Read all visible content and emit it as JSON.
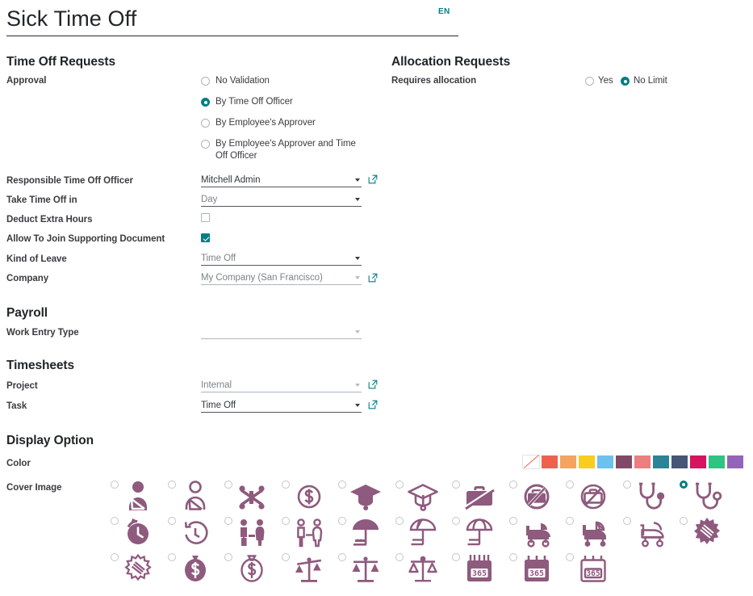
{
  "header": {
    "title": "Sick Time Off",
    "language_badge": "EN"
  },
  "groups": {
    "time_off_requests": "Time Off Requests",
    "allocation_requests": "Allocation Requests",
    "payroll": "Payroll",
    "timesheets": "Timesheets",
    "display_option": "Display Option"
  },
  "approval": {
    "label": "Approval",
    "options": [
      {
        "label": "No Validation",
        "selected": false
      },
      {
        "label": "By Time Off Officer",
        "selected": true
      },
      {
        "label": "By Employee's Approver",
        "selected": false
      },
      {
        "label": "By Employee's Approver and Time Off Officer",
        "selected": false
      }
    ]
  },
  "allocation": {
    "label": "Requires allocation",
    "options": [
      {
        "label": "Yes",
        "selected": false
      },
      {
        "label": "No Limit",
        "selected": true
      }
    ]
  },
  "fields": [
    {
      "label": "Responsible Time Off Officer",
      "value": "Mitchell Admin",
      "tone": "strong",
      "caret": "dark",
      "underline": "dark",
      "external": true
    },
    {
      "label": "Take Time Off in",
      "value": "Day",
      "tone": "muted",
      "caret": "dark",
      "underline": "dark",
      "external": false
    },
    {
      "label": "Kind of Leave",
      "value": "Time Off",
      "tone": "muted",
      "caret": "dark",
      "underline": "dark",
      "external": false
    },
    {
      "label": "Company",
      "value": "My Company (San Francisco)",
      "tone": "muted",
      "caret": "light",
      "underline": "light",
      "external": true
    },
    {
      "label": "Work Entry Type",
      "value": "",
      "tone": "muted",
      "caret": "light",
      "underline": "light",
      "external": false
    },
    {
      "label": "Project",
      "value": "Internal",
      "tone": "muted",
      "caret": "light",
      "underline": "light",
      "external": true
    },
    {
      "label": "Task",
      "value": "Time Off",
      "tone": "strong",
      "caret": "dark",
      "underline": "dark",
      "external": true
    }
  ],
  "checkboxes": [
    {
      "label": "Deduct Extra Hours",
      "checked": false
    },
    {
      "label": "Allow To Join Supporting Document",
      "checked": true
    }
  ],
  "color": {
    "label": "Color",
    "selected_index": 0,
    "swatches": [
      {
        "name": "no-color",
        "hex": "#ffffff"
      },
      {
        "name": "red",
        "hex": "#f06050"
      },
      {
        "name": "orange",
        "hex": "#f4a460"
      },
      {
        "name": "yellow",
        "hex": "#f7cd1f"
      },
      {
        "name": "light-blue",
        "hex": "#6cc1ed"
      },
      {
        "name": "dark-purple",
        "hex": "#814968"
      },
      {
        "name": "salmon-pink",
        "hex": "#eb7e7f"
      },
      {
        "name": "medium-blue",
        "hex": "#2c8397"
      },
      {
        "name": "dark-blue",
        "hex": "#475577"
      },
      {
        "name": "fuchsia",
        "hex": "#d6145f"
      },
      {
        "name": "green",
        "hex": "#30c381"
      },
      {
        "name": "purple",
        "hex": "#9365b8"
      }
    ]
  },
  "cover_image": {
    "label": "Cover Image",
    "icon_color": "#8e5a7d",
    "selected": "stethoscope-outline",
    "rows": [
      [
        {
          "name": "person-arm-sling-filled",
          "selected": false
        },
        {
          "name": "person-arm-sling-outline",
          "selected": false
        },
        {
          "name": "money-scissors",
          "selected": false
        },
        {
          "name": "dollar-circle-outline",
          "selected": false
        },
        {
          "name": "graduation-cap-filled",
          "selected": false
        },
        {
          "name": "graduation-cap-outline",
          "selected": false
        },
        {
          "name": "briefcase-slash-filled",
          "selected": false
        },
        {
          "name": "briefcase-no-filled",
          "selected": false
        },
        {
          "name": "briefcase-no-outline",
          "selected": false
        },
        {
          "name": "stethoscope-filled",
          "selected": false
        },
        {
          "name": "stethoscope-outline",
          "selected": true
        }
      ],
      [
        {
          "name": "clock-rotate-filled",
          "selected": false
        },
        {
          "name": "clock-rotate-outline",
          "selected": false
        },
        {
          "name": "family-filled",
          "selected": false
        },
        {
          "name": "family-outline",
          "selected": false
        },
        {
          "name": "beach-umbrella-filled",
          "selected": false
        },
        {
          "name": "beach-umbrella-half",
          "selected": false
        },
        {
          "name": "beach-umbrella-outline",
          "selected": false
        },
        {
          "name": "baby-carriage-filled",
          "selected": false
        },
        {
          "name": "baby-carriage-half",
          "selected": false
        },
        {
          "name": "baby-carriage-outline",
          "selected": false
        },
        {
          "name": "virus-filled",
          "selected": false
        }
      ],
      [
        {
          "name": "virus-outline",
          "selected": false
        },
        {
          "name": "money-bag-filled",
          "selected": false
        },
        {
          "name": "money-bag-outline",
          "selected": false
        },
        {
          "name": "scale-unbalanced-filled",
          "selected": false
        },
        {
          "name": "scale-balanced-filled",
          "selected": false
        },
        {
          "name": "scale-balanced-outline",
          "selected": false
        },
        {
          "name": "calendar-365-filled",
          "selected": false
        },
        {
          "name": "calendar-365-half",
          "selected": false
        },
        {
          "name": "calendar-365-outline",
          "selected": false
        }
      ]
    ]
  }
}
